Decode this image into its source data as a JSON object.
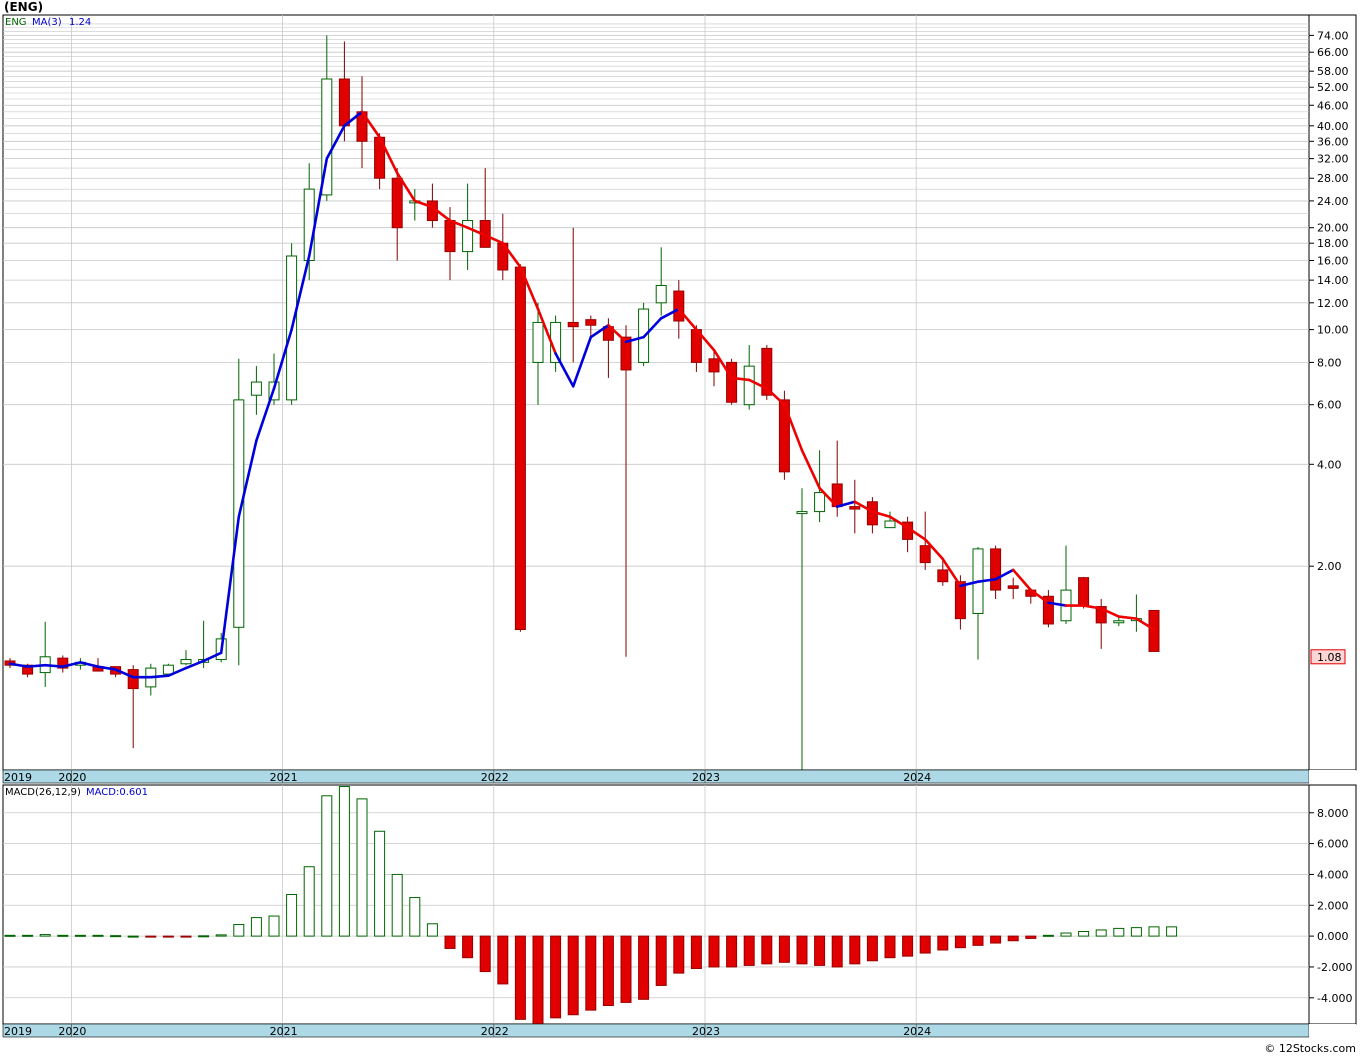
{
  "title": "(ENG)",
  "credit": "© 12Stocks.com",
  "colors": {
    "up": "#006400",
    "down": "#e00000",
    "ma_up": "#0000dd",
    "ma_down": "#ee0000",
    "axis_band": "#add8e6",
    "grid": "#c8c8c8"
  },
  "chart_data": [
    {
      "type": "candlestick",
      "legend": {
        "symbol": "ENG",
        "ma_label": "MA(3)",
        "ma_value": "1.24"
      },
      "y_scale": "log",
      "ylim": [
        0.5,
        85
      ],
      "y_ticks": [
        {
          "v": 74,
          "label": "74.00"
        },
        {
          "v": 66,
          "label": "66.00"
        },
        {
          "v": 58,
          "label": "58.00"
        },
        {
          "v": 52,
          "label": "52.00"
        },
        {
          "v": 46,
          "label": "46.00"
        },
        {
          "v": 40,
          "label": "40.00"
        },
        {
          "v": 36,
          "label": "36.00"
        },
        {
          "v": 32,
          "label": "32.00"
        },
        {
          "v": 28,
          "label": "28.00"
        },
        {
          "v": 24,
          "label": "24.00"
        },
        {
          "v": 20,
          "label": "20.00"
        },
        {
          "v": 18,
          "label": "18.00"
        },
        {
          "v": 16,
          "label": "16.00"
        },
        {
          "v": 14,
          "label": "14.00"
        },
        {
          "v": 12,
          "label": "12.00"
        },
        {
          "v": 10,
          "label": "10.00"
        },
        {
          "v": 8,
          "label": "8.00"
        },
        {
          "v": 6,
          "label": "6.00"
        },
        {
          "v": 4,
          "label": "4.00"
        },
        {
          "v": 2,
          "label": "2.00"
        }
      ],
      "last_price_label": "1.08",
      "last_price": 1.08,
      "x_labels": [
        {
          "i": 0,
          "label": "2019"
        },
        {
          "i": 4,
          "label": "2020"
        },
        {
          "i": 16,
          "label": "2021"
        },
        {
          "i": 28,
          "label": "2022"
        },
        {
          "i": 40,
          "label": "2023"
        },
        {
          "i": 52,
          "label": "2024"
        }
      ],
      "candles": [
        [
          1.05,
          1.07,
          1.0,
          1.02
        ],
        [
          1.02,
          1.03,
          0.94,
          0.96
        ],
        [
          0.97,
          1.37,
          0.88,
          1.08
        ],
        [
          1.07,
          1.09,
          0.97,
          1.0
        ],
        [
          1.02,
          1.07,
          0.99,
          1.04
        ],
        [
          1.01,
          1.07,
          0.98,
          0.98
        ],
        [
          1.01,
          1.01,
          0.94,
          0.96
        ],
        [
          0.99,
          1.02,
          0.58,
          0.87
        ],
        [
          0.88,
          1.03,
          0.83,
          1.0
        ],
        [
          0.96,
          1.03,
          0.95,
          1.02
        ],
        [
          1.03,
          1.13,
          1.02,
          1.06
        ],
        [
          1.04,
          1.38,
          1.0,
          1.06
        ],
        [
          1.06,
          1.27,
          1.04,
          1.22
        ],
        [
          1.32,
          8.2,
          1.02,
          6.2
        ],
        [
          6.4,
          7.8,
          5.6,
          7.0
        ],
        [
          6.2,
          8.5,
          6.0,
          7.0
        ],
        [
          6.2,
          18,
          6.0,
          16.5
        ],
        [
          16,
          31,
          14,
          26
        ],
        [
          25,
          74,
          24,
          55
        ],
        [
          55,
          71,
          36,
          40
        ],
        [
          44,
          56,
          30,
          36
        ],
        [
          37,
          38,
          26,
          28
        ],
        [
          28,
          30,
          16,
          20
        ],
        [
          24,
          26,
          21,
          24
        ],
        [
          24,
          27,
          20,
          21
        ],
        [
          21,
          23,
          14,
          17
        ],
        [
          17,
          27,
          15,
          21
        ],
        [
          21,
          30,
          18,
          17.5
        ],
        [
          18,
          22,
          14,
          15
        ],
        [
          15.3,
          15.6,
          1.28,
          1.3
        ],
        [
          8,
          12,
          6,
          10.5
        ],
        [
          8,
          11,
          7.5,
          10.5
        ],
        [
          10.5,
          20,
          8,
          10.2
        ],
        [
          10.7,
          11,
          9.5,
          10.3
        ],
        [
          10.2,
          10.8,
          7.2,
          9.3
        ],
        [
          9.5,
          10.3,
          1.08,
          7.6
        ],
        [
          8,
          12,
          7.8,
          11.5
        ],
        [
          12,
          17.5,
          11,
          13.5
        ],
        [
          13,
          14,
          9.4,
          10.6
        ],
        [
          10,
          10.3,
          7.5,
          8.0
        ],
        [
          8.2,
          8.6,
          6.8,
          7.5
        ],
        [
          8,
          8.2,
          6.0,
          6.1
        ],
        [
          6,
          9,
          5.8,
          7.8
        ],
        [
          8.8,
          9.0,
          6.2,
          6.4
        ],
        [
          6.2,
          6.6,
          3.6,
          3.8
        ],
        [
          2.9,
          3.4,
          0.5,
          2.9
        ],
        [
          2.9,
          4.4,
          2.7,
          3.3
        ],
        [
          3.5,
          4.7,
          2.8,
          3.0
        ],
        [
          3.0,
          3.6,
          2.5,
          2.95
        ],
        [
          3.1,
          3.2,
          2.5,
          2.65
        ],
        [
          2.6,
          2.9,
          2.6,
          2.72
        ],
        [
          2.7,
          2.8,
          2.2,
          2.4
        ],
        [
          2.3,
          2.9,
          1.95,
          2.05
        ],
        [
          1.95,
          2.1,
          1.75,
          1.8
        ],
        [
          1.8,
          1.88,
          1.3,
          1.4
        ],
        [
          1.45,
          2.28,
          1.06,
          2.25
        ],
        [
          2.25,
          2.3,
          1.6,
          1.7
        ],
        [
          1.75,
          1.85,
          1.6,
          1.72
        ],
        [
          1.7,
          1.72,
          1.55,
          1.63
        ],
        [
          1.63,
          1.7,
          1.32,
          1.35
        ],
        [
          1.38,
          2.3,
          1.35,
          1.7
        ],
        [
          1.85,
          1.86,
          1.5,
          1.53
        ],
        [
          1.52,
          1.6,
          1.14,
          1.36
        ],
        [
          1.37,
          1.42,
          1.33,
          1.38
        ],
        [
          1.4,
          1.65,
          1.28,
          1.4
        ],
        [
          1.48,
          1.48,
          1.12,
          1.12
        ]
      ],
      "ma3": [
        1.03,
        1.01,
        1.02,
        1.01,
        1.04,
        1.01,
        0.99,
        0.94,
        0.94,
        0.95,
        1.0,
        1.05,
        1.11,
        2.8,
        4.7,
        6.7,
        10,
        16.5,
        32,
        40,
        44,
        37,
        29,
        24,
        23,
        21,
        20,
        19,
        18,
        15.3,
        11.5,
        8.5,
        6.8,
        9.5,
        10.3,
        9.2,
        9.5,
        10.8,
        11.5,
        10,
        8.7,
        7.2,
        7.1,
        6.7,
        6.0,
        4.4,
        3.4,
        3.0,
        3.1,
        2.9,
        2.8,
        2.6,
        2.4,
        2.1,
        1.75,
        1.8,
        1.83,
        1.95,
        1.7,
        1.56,
        1.53,
        1.53,
        1.5,
        1.42,
        1.4,
        1.3
      ],
      "ma3_color": [
        "up",
        "up",
        "up",
        "up",
        "up",
        "up",
        "up",
        "up",
        "up",
        "up",
        "up",
        "up",
        "up",
        "up",
        "up",
        "up",
        "up",
        "up",
        "up",
        "up",
        "up",
        "down",
        "down",
        "down",
        "down",
        "down",
        "down",
        "down",
        "down",
        "down",
        "down",
        "down",
        "up",
        "up",
        "up",
        "down",
        "up",
        "up",
        "up",
        "down",
        "down",
        "down",
        "down",
        "down",
        "down",
        "down",
        "down",
        "down",
        "up",
        "down",
        "down",
        "down",
        "down",
        "down",
        "down",
        "up",
        "up",
        "up",
        "down",
        "down",
        "up",
        "down",
        "down",
        "down",
        "down",
        "down"
      ]
    },
    {
      "type": "bar",
      "legend": {
        "name": "MACD(26,12,9)",
        "value_label": "MACD:0.601"
      },
      "ylim": [
        -5.7,
        9.8
      ],
      "y_ticks": [
        {
          "v": 8,
          "label": "8.000"
        },
        {
          "v": 6,
          "label": "6.000"
        },
        {
          "v": 4,
          "label": "4.000"
        },
        {
          "v": 2,
          "label": "2.000"
        },
        {
          "v": 0,
          "label": "0.000"
        },
        {
          "v": -2,
          "label": "-2.000"
        },
        {
          "v": -4,
          "label": "-4.000"
        }
      ],
      "x_labels": [
        {
          "i": 0,
          "label": "2019"
        },
        {
          "i": 4,
          "label": "2020"
        },
        {
          "i": 16,
          "label": "2021"
        },
        {
          "i": 28,
          "label": "2022"
        },
        {
          "i": 40,
          "label": "2023"
        },
        {
          "i": 52,
          "label": "2024"
        }
      ],
      "values": [
        0.05,
        0.05,
        0.1,
        0.05,
        0.05,
        0.05,
        0.03,
        0.0,
        -0.02,
        -0.02,
        -0.03,
        0.02,
        0.08,
        0.75,
        1.2,
        1.3,
        2.7,
        4.5,
        9.1,
        9.7,
        8.9,
        6.8,
        4.0,
        2.5,
        0.8,
        -0.8,
        -1.4,
        -2.3,
        -3.1,
        -5.4,
        -5.7,
        -5.3,
        -5.1,
        -4.8,
        -4.5,
        -4.3,
        -4.1,
        -3.2,
        -2.4,
        -2.1,
        -2.0,
        -2.0,
        -1.9,
        -1.8,
        -1.7,
        -1.8,
        -1.9,
        -2.0,
        -1.8,
        -1.6,
        -1.4,
        -1.3,
        -1.1,
        -0.9,
        -0.75,
        -0.6,
        -0.45,
        -0.3,
        -0.15,
        0.05,
        0.2,
        0.3,
        0.4,
        0.5,
        0.55,
        0.6,
        0.6
      ]
    }
  ]
}
